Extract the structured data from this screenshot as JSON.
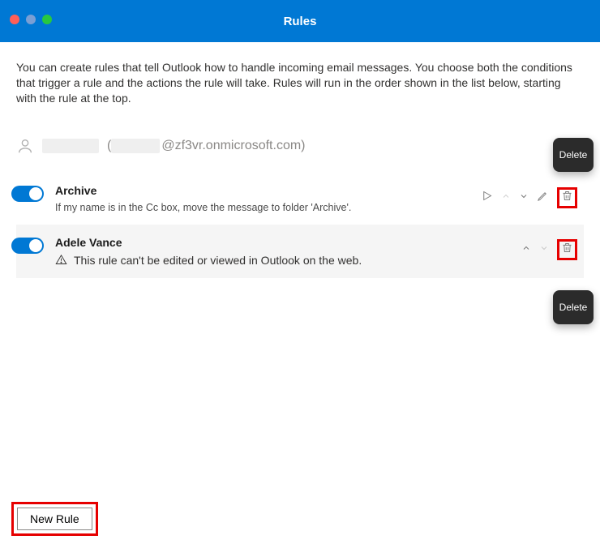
{
  "window": {
    "title": "Rules"
  },
  "intro": "You can create rules that tell Outlook how to handle incoming email messages. You choose both the conditions that trigger a rule and the actions the rule will take. Rules will run in the order shown in the list below, starting with the rule at the top.",
  "account": {
    "domain_suffix": "@zf3vr.onmicrosoft.com)",
    "open_paren": " ("
  },
  "rules": [
    {
      "name": "Archive",
      "description": "If my name is in the Cc box, move the message to folder 'Archive'.",
      "enabled": true
    },
    {
      "name": "Adele Vance",
      "warning": "This rule can't be edited or viewed in Outlook on the web.",
      "enabled": true
    }
  ],
  "tooltips": {
    "delete1": "Delete",
    "delete2": "Delete"
  },
  "buttons": {
    "new_rule": "New Rule"
  }
}
